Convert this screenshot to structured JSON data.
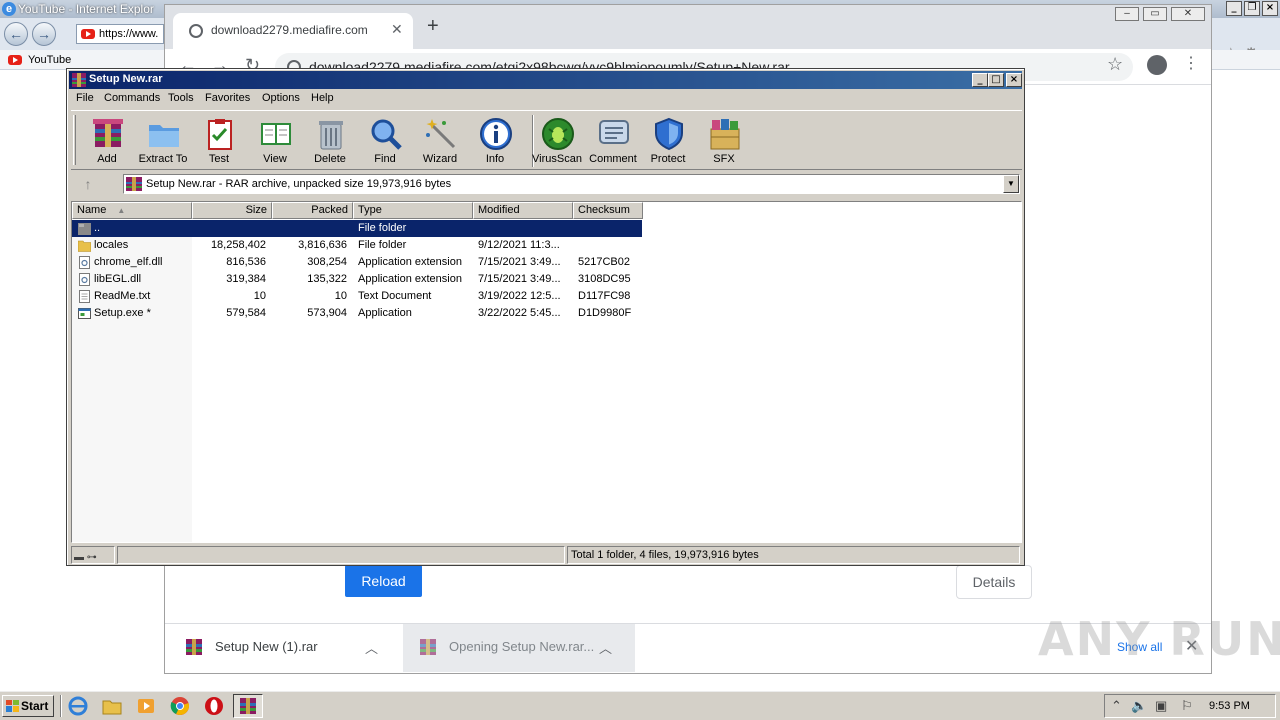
{
  "ie": {
    "title": "YouTube - Internet Explor",
    "address": "https://www.",
    "favorites_item": "YouTube"
  },
  "chrome": {
    "tab_title": "download2279.mediafire.com",
    "url": "download2279.mediafire.com/etgi2x98bcwg/yvc9blmjopoumly/Setup+New.rar",
    "reload_label": "Reload",
    "details_label": "Details",
    "downloads": [
      {
        "label": "Setup New (1).rar"
      },
      {
        "label": "Opening Setup New.rar..."
      }
    ],
    "show_all": "Show all",
    "watermark": "ANY RUN"
  },
  "winrar": {
    "title": "Setup New.rar",
    "menu": [
      "File",
      "Commands",
      "Tools",
      "Favorites",
      "Options",
      "Help"
    ],
    "toolbar": [
      {
        "label": "Add",
        "icon": "add-archive-icon"
      },
      {
        "label": "Extract To",
        "icon": "extract-folder-icon"
      },
      {
        "label": "Test",
        "icon": "test-clipboard-icon"
      },
      {
        "label": "View",
        "icon": "view-book-icon"
      },
      {
        "label": "Delete",
        "icon": "trash-icon"
      },
      {
        "label": "Find",
        "icon": "magnifier-icon"
      },
      {
        "label": "Wizard",
        "icon": "magic-wand-icon"
      },
      {
        "label": "Info",
        "icon": "info-icon"
      },
      {
        "label": "VirusScan",
        "icon": "virus-scan-icon"
      },
      {
        "label": "Comment",
        "icon": "comment-icon"
      },
      {
        "label": "Protect",
        "icon": "shield-icon"
      },
      {
        "label": "SFX",
        "icon": "sfx-box-icon"
      }
    ],
    "path": "Setup New.rar - RAR archive, unpacked size 19,973,916 bytes",
    "columns": [
      "Name",
      "Size",
      "Packed",
      "Type",
      "Modified",
      "Checksum"
    ],
    "rows": [
      {
        "name": "..",
        "size": "",
        "packed": "",
        "type": "File folder",
        "modified": "",
        "checksum": "",
        "kind": "parent"
      },
      {
        "name": "locales",
        "size": "18,258,402",
        "packed": "3,816,636",
        "type": "File folder",
        "modified": "9/12/2021 11:3...",
        "checksum": "",
        "kind": "folder"
      },
      {
        "name": "chrome_elf.dll",
        "size": "816,536",
        "packed": "308,254",
        "type": "Application extension",
        "modified": "7/15/2021 3:49...",
        "checksum": "5217CB02",
        "kind": "dll"
      },
      {
        "name": "libEGL.dll",
        "size": "319,384",
        "packed": "135,322",
        "type": "Application extension",
        "modified": "7/15/2021 3:49...",
        "checksum": "3108DC95",
        "kind": "dll"
      },
      {
        "name": "ReadMe.txt",
        "size": "10",
        "packed": "10",
        "type": "Text Document",
        "modified": "3/19/2022 12:5...",
        "checksum": "D117FC98",
        "kind": "txt"
      },
      {
        "name": "Setup.exe *",
        "size": "579,584",
        "packed": "573,904",
        "type": "Application",
        "modified": "3/22/2022 5:45...",
        "checksum": "D1D9980F",
        "kind": "exe"
      }
    ],
    "status": "Total 1 folder, 4 files, 19,973,916 bytes"
  },
  "taskbar": {
    "start_label": "Start",
    "clock": "9:53 PM"
  },
  "colors": {
    "winrar_title": "#0a246a",
    "selection": "#0a246a",
    "chrome_blue": "#1a73e8",
    "classic_gray": "#d4d0c8"
  }
}
